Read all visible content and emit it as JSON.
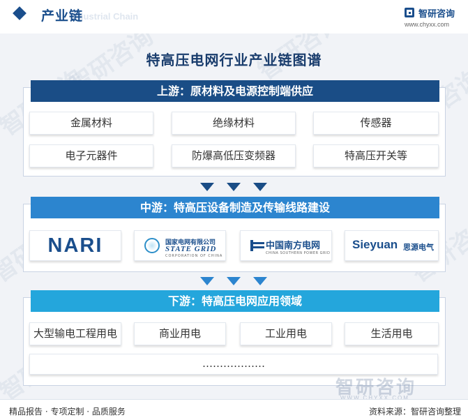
{
  "header": {
    "title": "产业链",
    "title_en": "Industrial Chain",
    "logo_name": "智研咨询",
    "logo_url": "www.chyxx.com"
  },
  "watermark": "智研咨询",
  "main_title": "特高压电网行业产业链图谱",
  "upstream": {
    "title": "上游：原材料及电源控制端供应",
    "items": [
      "金属材料",
      "绝缘材料",
      "传感器",
      "电子元器件",
      "防爆高低压变频器",
      "特高压开关等"
    ]
  },
  "midstream": {
    "title": "中游：特高压设备制造及传输线路建设",
    "logos": {
      "nari": "NARI",
      "sgcc_cn": "国家电网有限公司",
      "sgcc_en": "STATE GRID",
      "sgcc_sub": "CORPORATION OF CHINA",
      "csg_cn": "中国南方电网",
      "csg_en": "CHINA SOUTHERN POWER GRID",
      "sieyuan_en": "Sieyuan",
      "sieyuan_cn": "思源电气"
    }
  },
  "downstream": {
    "title": "下游：特高压电网应用领域",
    "items": [
      "大型输电工程用电",
      "商业用电",
      "工业用电",
      "生活用电"
    ],
    "more": "………………"
  },
  "footer": {
    "left": "精品报告 · 专项定制 · 品质服务",
    "right": "资料来源：智研咨询整理",
    "watermark_name": "智研咨询",
    "watermark_url": "WWW.CHYXX.COM"
  },
  "colors": {
    "upstream": "#1a4d86",
    "midstream": "#2c85cf",
    "downstream": "#24a6dc"
  }
}
